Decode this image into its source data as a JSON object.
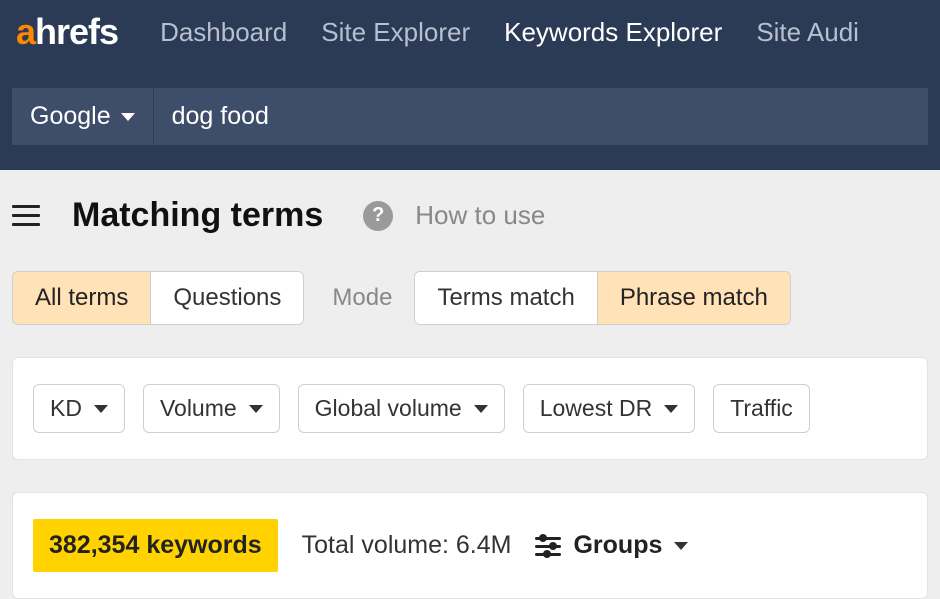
{
  "header": {
    "logo": {
      "first": "a",
      "rest": "hrefs"
    },
    "nav": [
      {
        "label": "Dashboard",
        "active": false
      },
      {
        "label": "Site Explorer",
        "active": false
      },
      {
        "label": "Keywords Explorer",
        "active": true
      },
      {
        "label": "Site Audi",
        "active": false
      }
    ],
    "search": {
      "engine": "Google",
      "query": "dog food"
    }
  },
  "page": {
    "title": "Matching terms",
    "how_to_use": "How to use"
  },
  "tabs": {
    "group1": [
      {
        "label": "All terms",
        "active": true
      },
      {
        "label": "Questions",
        "active": false
      }
    ],
    "mode_label": "Mode",
    "group2": [
      {
        "label": "Terms match",
        "active": false
      },
      {
        "label": "Phrase match",
        "active": true
      }
    ]
  },
  "filters": [
    {
      "label": "KD"
    },
    {
      "label": "Volume"
    },
    {
      "label": "Global volume"
    },
    {
      "label": "Lowest DR"
    },
    {
      "label": "Traffic"
    }
  ],
  "summary": {
    "keyword_count": "382,354 keywords",
    "total_volume": "Total volume: 6.4M",
    "groups_label": "Groups"
  }
}
